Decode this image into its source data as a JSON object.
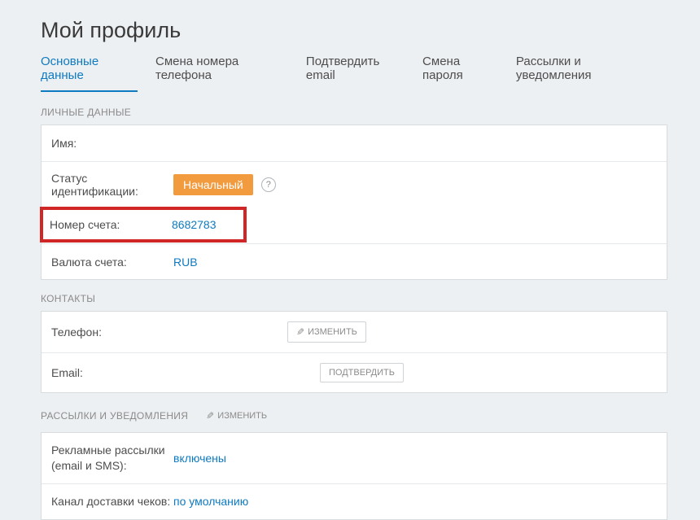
{
  "pageTitle": "Мой профиль",
  "tabs": [
    {
      "label": "Основные данные",
      "active": true
    },
    {
      "label": "Смена номера телефона",
      "active": false
    },
    {
      "label": "Подтвердить email",
      "active": false
    },
    {
      "label": "Смена пароля",
      "active": false
    },
    {
      "label": "Рассылки и уведомления",
      "active": false
    }
  ],
  "sections": {
    "personal": {
      "header": "ЛИЧНЫЕ ДАННЫЕ",
      "nameLabel": "Имя:",
      "nameValue": "",
      "statusLabel": "Статус идентификации:",
      "statusBadge": "Начальный",
      "helpSymbol": "?",
      "accountLabel": "Номер счета:",
      "accountValue": "8682783",
      "currencyLabel": "Валюта счета:",
      "currencyValue": "RUB"
    },
    "contacts": {
      "header": "КОНТАКТЫ",
      "phoneLabel": "Телефон:",
      "phoneValue": "",
      "changeBtn": "ИЗМЕНИТЬ",
      "emailLabel": "Email:",
      "emailValue": "",
      "confirmBtn": "ПОДТВЕРДИТЬ"
    },
    "notifications": {
      "header": "РАССЫЛКИ И УВЕДОМЛЕНИЯ",
      "editBtn": "ИЗМЕНИТЬ",
      "adLabelLine1": "Рекламные рассылки",
      "adLabelLine2": "(email и SMS):",
      "adValue": "включены",
      "receiptLabel": "Канал доставки чеков:",
      "receiptValue": "по умолчанию"
    }
  }
}
